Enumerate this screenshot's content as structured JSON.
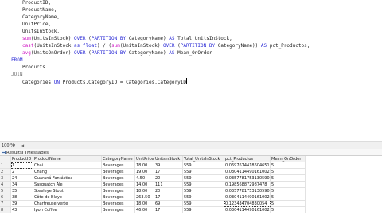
{
  "editor": {
    "lines": [
      [
        {
          "t": "ProductID,",
          "c": "plain"
        }
      ],
      [
        {
          "t": "ProductName,",
          "c": "plain"
        }
      ],
      [
        {
          "t": "CategoryName,",
          "c": "plain"
        }
      ],
      [
        {
          "t": "UnitPrice,",
          "c": "plain"
        }
      ],
      [
        {
          "t": "UnitsInStock,",
          "c": "plain"
        }
      ],
      [
        {
          "t": "sum",
          "c": "fn"
        },
        {
          "t": "(UnitsInStock) ",
          "c": "plain"
        },
        {
          "t": "OVER",
          "c": "kw"
        },
        {
          "t": " (",
          "c": "plain"
        },
        {
          "t": "PARTITION BY",
          "c": "kw"
        },
        {
          "t": " CategoryName) ",
          "c": "plain"
        },
        {
          "t": "AS",
          "c": "kw"
        },
        {
          "t": " Total_UnitsInStock,",
          "c": "plain"
        }
      ],
      [
        {
          "t": "cast",
          "c": "fn"
        },
        {
          "t": "(UnitsInStock ",
          "c": "plain"
        },
        {
          "t": "as",
          "c": "kw"
        },
        {
          "t": " ",
          "c": "plain"
        },
        {
          "t": "float",
          "c": "kw"
        },
        {
          "t": ") / (",
          "c": "plain"
        },
        {
          "t": "sum",
          "c": "fn"
        },
        {
          "t": "(UnitsInStock) ",
          "c": "plain"
        },
        {
          "t": "OVER",
          "c": "kw"
        },
        {
          "t": " (",
          "c": "plain"
        },
        {
          "t": "PARTITION BY",
          "c": "kw"
        },
        {
          "t": " CategoryName)) ",
          "c": "plain"
        },
        {
          "t": "AS",
          "c": "kw"
        },
        {
          "t": " pct_Productos,",
          "c": "plain"
        }
      ],
      [
        {
          "t": "avg",
          "c": "fn"
        },
        {
          "t": "(UnitsOnOrder) ",
          "c": "plain"
        },
        {
          "t": "OVER",
          "c": "kw"
        },
        {
          "t": " (",
          "c": "plain"
        },
        {
          "t": "PARTITION BY",
          "c": "kw"
        },
        {
          "t": " CategoryName) ",
          "c": "plain"
        },
        {
          "t": "AS",
          "c": "kw"
        },
        {
          "t": " Mean_OnOrder",
          "c": "plain"
        }
      ],
      [
        {
          "t": "FROM",
          "c": "kw"
        }
      ],
      [
        {
          "t": "Products",
          "c": "plain"
        }
      ],
      [
        {
          "t": "JOIN",
          "c": "gray"
        }
      ],
      [
        {
          "t": "Categories ",
          "c": "plain"
        },
        {
          "t": "ON",
          "c": "kw"
        },
        {
          "t": " Products.CategoryID = Categories.CategoryID",
          "c": "plain"
        }
      ]
    ]
  },
  "status": {
    "zoom": "100 %",
    "zoom_arrow": "▼",
    "scroll_left": "◀"
  },
  "tabs": {
    "results": "Results",
    "messages": "Messages"
  },
  "grid": {
    "columns": [
      "ProductID",
      "ProductName",
      "CategoryName",
      "UnitPrice",
      "UnitsInStock",
      "Total_UnitsInStock",
      "pct_Productos",
      "Mean_OnOrder"
    ],
    "rows": [
      [
        "1",
        "1",
        "Chai",
        "Beverages",
        "18.00",
        "39",
        "559",
        "0.0697674418604651",
        "5"
      ],
      [
        "2",
        "2",
        "Chang",
        "Beverages",
        "19.00",
        "17",
        "559",
        "0.0304114490161002",
        "5"
      ],
      [
        "3",
        "24",
        "Guaraná Fantástica",
        "Beverages",
        "4.50",
        "20",
        "559",
        "0.0357781753130590",
        "5"
      ],
      [
        "4",
        "34",
        "Sasquatch Ale",
        "Beverages",
        "14.00",
        "111",
        "559",
        "0.198568872987478",
        "5"
      ],
      [
        "5",
        "35",
        "Steeleye Stout",
        "Beverages",
        "18.00",
        "20",
        "559",
        "0.0357781753130590",
        "5"
      ],
      [
        "6",
        "38",
        "Côte de Blaye",
        "Beverages",
        "263.50",
        "17",
        "559",
        "0.0304114490161002",
        "5"
      ],
      [
        "7",
        "39",
        "Chartreuse verte",
        "Beverages",
        "18.00",
        "69",
        "559",
        "0.123434704830054",
        "5"
      ],
      [
        "8",
        "43",
        "Ipoh Coffee",
        "Beverages",
        "46.00",
        "17",
        "559",
        "0.0304114490161002",
        "5"
      ]
    ]
  }
}
